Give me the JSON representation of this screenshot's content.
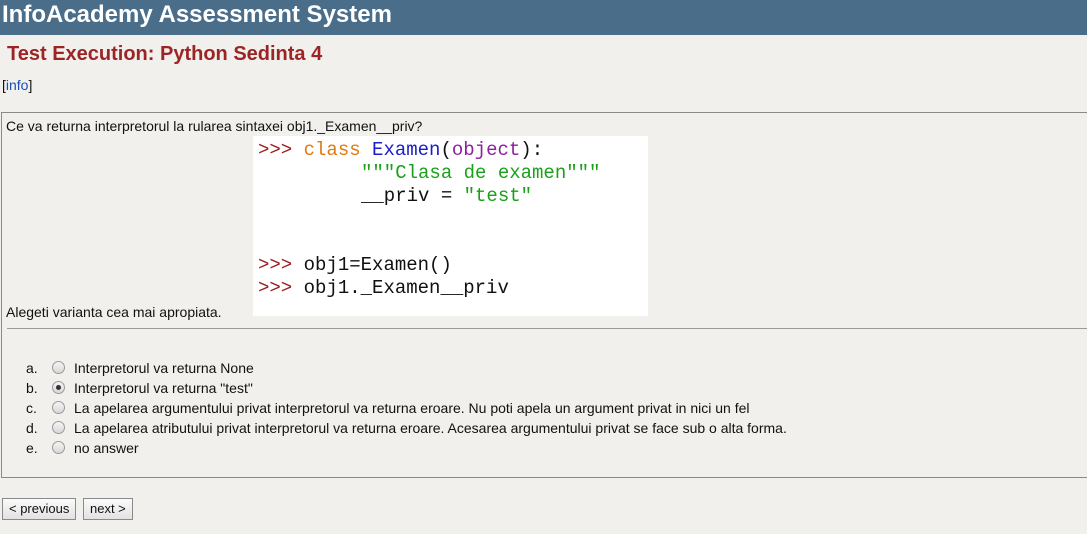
{
  "header": {
    "app_title": "InfoAcademy Assessment System"
  },
  "page": {
    "title": "Test Execution: Python Sedinta 4",
    "info_open": "[",
    "info_link": "info",
    "info_close": "]"
  },
  "question": {
    "text": "Ce va returna interpretorul la rularea sintaxei obj1._Examen__priv?",
    "code": {
      "prompt": ">>>",
      "kw_class": "class",
      "class_name": "Examen",
      "open_paren": "(",
      "base": "object",
      "close": "):",
      "docstring": "\"\"\"Clasa de examen\"\"\"",
      "attr": "__priv = ",
      "attr_value": "\"test\"",
      "stmt1": "obj1=Examen()",
      "stmt2": "obj1._Examen__priv"
    },
    "hint": "Alegeti varianta cea mai apropiata."
  },
  "options": [
    {
      "letter": "a.",
      "label": "Interpretorul va returna None",
      "checked": false
    },
    {
      "letter": "b.",
      "label": "Interpretorul va returna \"test\"",
      "checked": true
    },
    {
      "letter": "c.",
      "label": "La apelarea argumentului privat interpretorul va returna eroare. Nu poti apela un argument privat in nici un fel",
      "checked": false
    },
    {
      "letter": "d.",
      "label": "La apelarea atributului privat interpretorul va returna eroare. Acesarea argumentului privat se face sub o alta forma.",
      "checked": false
    },
    {
      "letter": "e.",
      "label": "no answer",
      "checked": false
    }
  ],
  "nav": {
    "previous_label": "< previous",
    "next_label": "next >"
  }
}
